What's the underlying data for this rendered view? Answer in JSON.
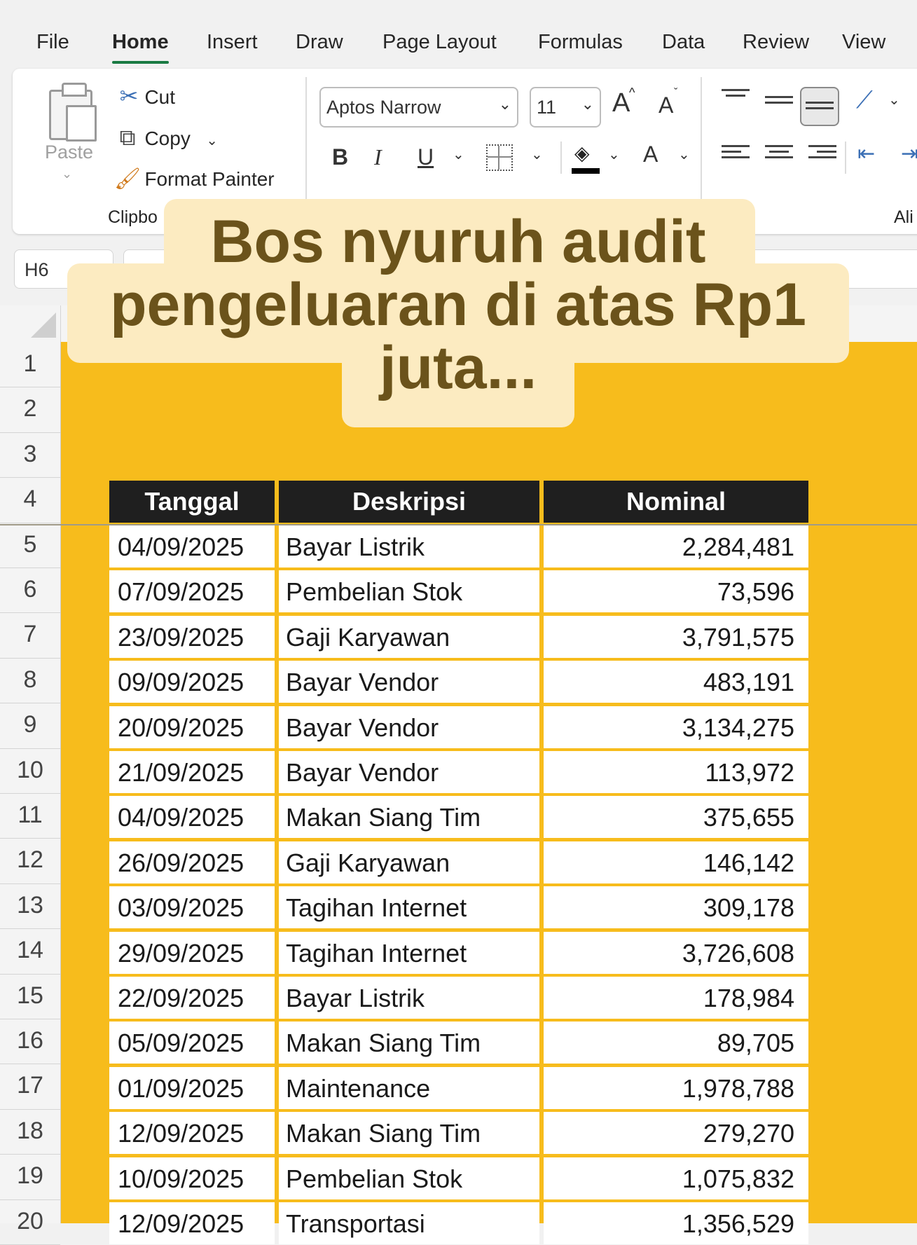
{
  "menu": {
    "tabs": [
      {
        "label": "File"
      },
      {
        "label": "Home"
      },
      {
        "label": "Insert"
      },
      {
        "label": "Draw"
      },
      {
        "label": "Page Layout"
      },
      {
        "label": "Formulas"
      },
      {
        "label": "Data"
      },
      {
        "label": "Review"
      },
      {
        "label": "View"
      }
    ],
    "active_tab": "Home"
  },
  "ribbon": {
    "clipboard": {
      "paste_label": "Paste",
      "cut_label": "Cut",
      "copy_label": "Copy",
      "format_painter_label": "Format Painter",
      "group_label": "Clipbo"
    },
    "font": {
      "font_name": "Aptos Narrow",
      "font_size": "11",
      "bold": "B",
      "italic": "I",
      "underline": "U",
      "grow_font": "A",
      "shrink_font": "A",
      "font_color": "A"
    },
    "alignment": {
      "group_label": "Ali"
    }
  },
  "formula_bar": {
    "name_box": "H6"
  },
  "caption": {
    "text": "Bos nyuruh audit pengeluaran di atas Rp1 juta..."
  },
  "row_numbers": [
    "1",
    "2",
    "3",
    "4",
    "5",
    "6",
    "7",
    "8",
    "9",
    "10",
    "11",
    "12",
    "13",
    "14",
    "15",
    "16",
    "17",
    "18",
    "19",
    "20"
  ],
  "table": {
    "headers": {
      "date": "Tanggal",
      "desc": "Deskripsi",
      "amount": "Nominal"
    },
    "rows": [
      {
        "date": "04/09/2025",
        "desc": "Bayar Listrik",
        "amount": "2,284,481"
      },
      {
        "date": "07/09/2025",
        "desc": "Pembelian Stok",
        "amount": "73,596"
      },
      {
        "date": "23/09/2025",
        "desc": "Gaji Karyawan",
        "amount": "3,791,575"
      },
      {
        "date": "09/09/2025",
        "desc": "Bayar Vendor",
        "amount": "483,191"
      },
      {
        "date": "20/09/2025",
        "desc": "Bayar Vendor",
        "amount": "3,134,275"
      },
      {
        "date": "21/09/2025",
        "desc": "Bayar Vendor",
        "amount": "113,972"
      },
      {
        "date": "04/09/2025",
        "desc": "Makan Siang Tim",
        "amount": "375,655"
      },
      {
        "date": "26/09/2025",
        "desc": "Gaji Karyawan",
        "amount": "146,142"
      },
      {
        "date": "03/09/2025",
        "desc": "Tagihan Internet",
        "amount": "309,178"
      },
      {
        "date": "29/09/2025",
        "desc": "Tagihan Internet",
        "amount": "3,726,608"
      },
      {
        "date": "22/09/2025",
        "desc": "Bayar Listrik",
        "amount": "178,984"
      },
      {
        "date": "05/09/2025",
        "desc": "Makan Siang Tim",
        "amount": "89,705"
      },
      {
        "date": "01/09/2025",
        "desc": "Maintenance",
        "amount": "1,978,788"
      },
      {
        "date": "12/09/2025",
        "desc": "Makan Siang Tim",
        "amount": "279,270"
      },
      {
        "date": "10/09/2025",
        "desc": "Pembelian Stok",
        "amount": "1,075,832"
      },
      {
        "date": "12/09/2025",
        "desc": "Transportasi",
        "amount": "1,356,529"
      }
    ]
  },
  "colors": {
    "sheet_fill": "#f7bc1c",
    "header_fill": "#1f1f1f",
    "caption_bg": "#fcebc1",
    "caption_text": "#6b531b",
    "active_tab_underline": "#1a7a43"
  }
}
